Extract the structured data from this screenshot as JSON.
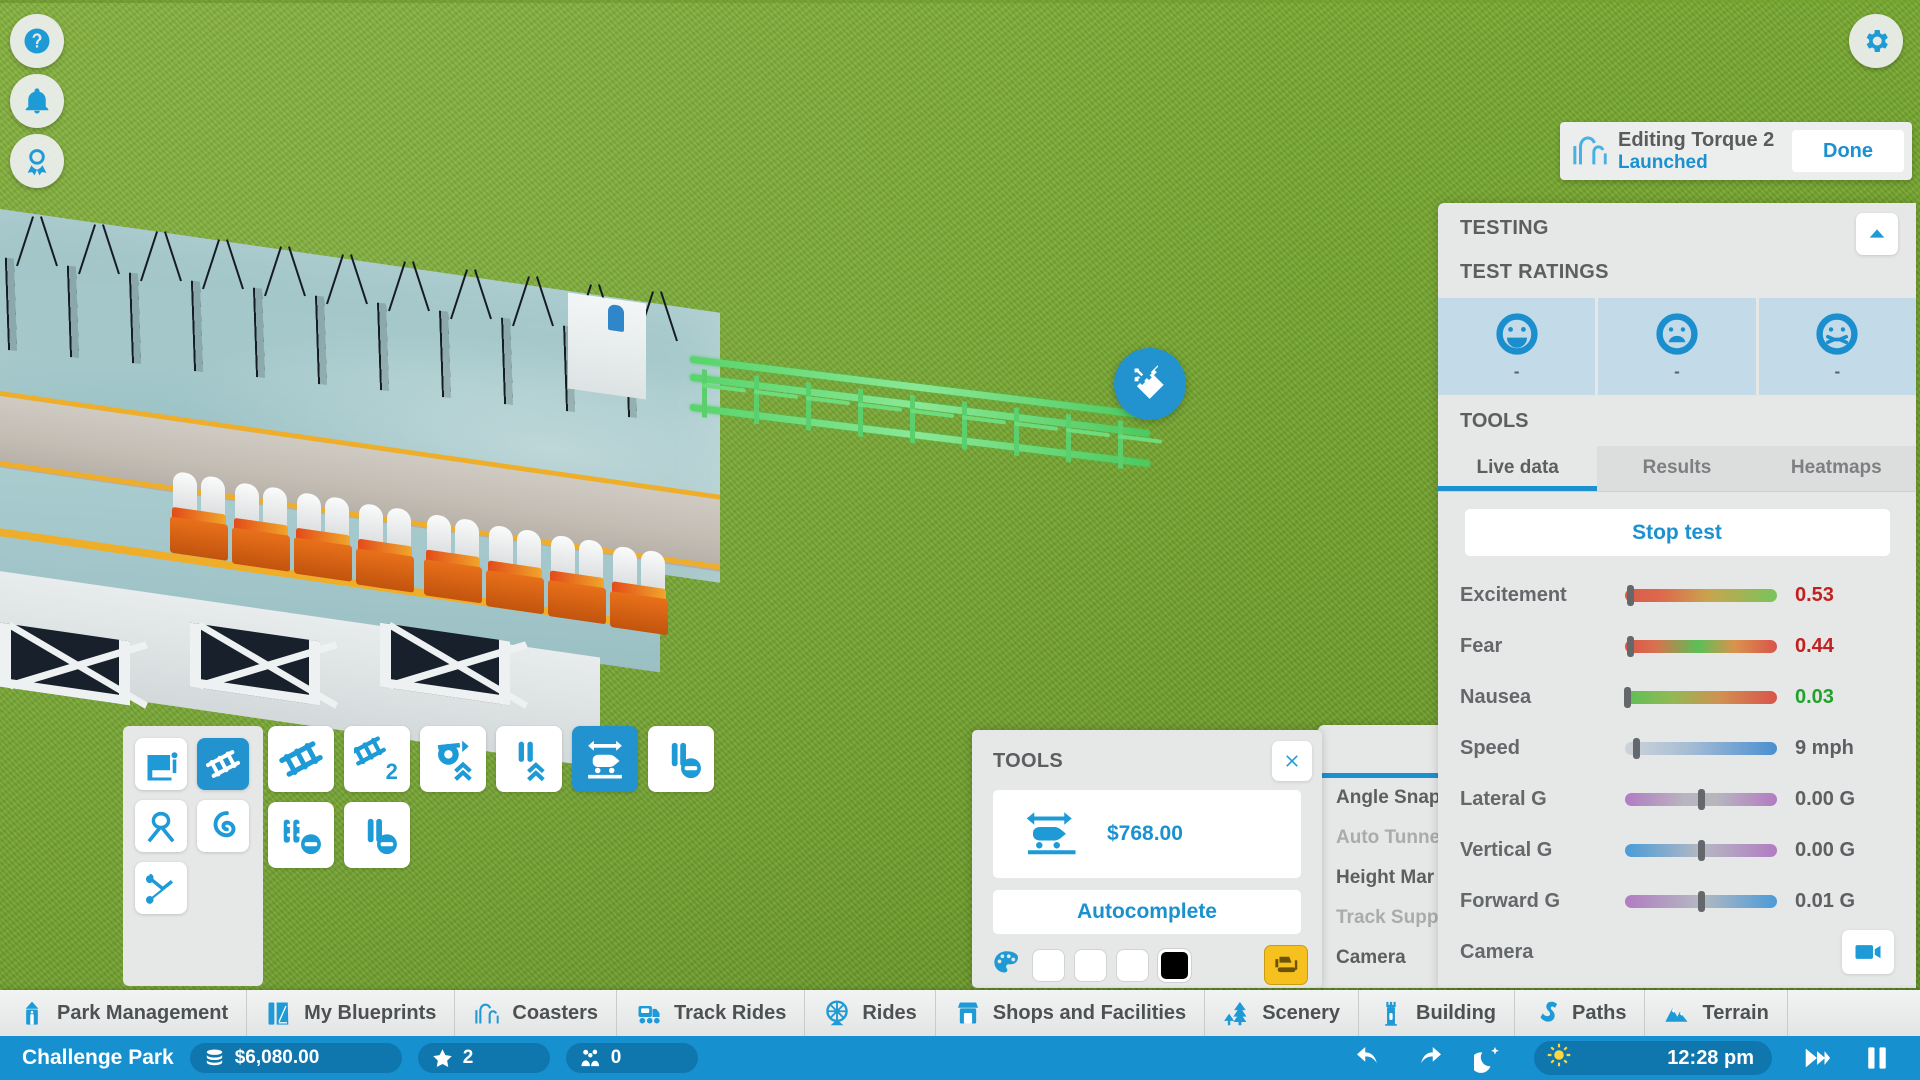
{
  "top_left_buttons": [
    {
      "name": "help-button",
      "icon": "question-icon"
    },
    {
      "name": "notifications-button",
      "icon": "bell-icon"
    },
    {
      "name": "awards-button",
      "icon": "award-icon"
    }
  ],
  "top_right_buttons": [
    {
      "name": "settings-button",
      "icon": "gear-icon"
    }
  ],
  "map_badge": {
    "icon": "measure-ruler-icon"
  },
  "edit_banner": {
    "icon": "coaster-icon",
    "title": "Editing Torque 2",
    "subtitle": "Launched",
    "done_label": "Done"
  },
  "testing_panel": {
    "heading": "TESTING",
    "subheading": "TEST RATINGS",
    "collapse_icon": "chevron-up-icon",
    "ratings": [
      {
        "name": "excitement-rating",
        "icon": "smiley-happy-icon",
        "value": "-"
      },
      {
        "name": "fear-rating",
        "icon": "smiley-fear-icon",
        "value": "-"
      },
      {
        "name": "nausea-rating",
        "icon": "smiley-nausea-icon",
        "value": "-"
      }
    ],
    "tools_label": "TOOLS",
    "tabs": [
      {
        "label": "Live data",
        "active": true
      },
      {
        "label": "Results",
        "active": false
      },
      {
        "label": "Heatmaps",
        "active": false
      }
    ],
    "stop_test_label": "Stop test",
    "metrics": [
      {
        "label": "Excitement",
        "value": "0.53",
        "value_color": "#c32020",
        "knob_pct": 3,
        "gradient": "linear-gradient(90deg,#d95a4a 0%,#dd6b4d 25%,#c9a44e 55%,#79c45a 100%)"
      },
      {
        "label": "Fear",
        "value": "0.44",
        "value_color": "#c32020",
        "knob_pct": 3,
        "gradient": "linear-gradient(90deg,#d9544a 0%,#d9714e 20%,#5cbf57 48%,#d9934e 72%,#d9544a 100%)"
      },
      {
        "label": "Nausea",
        "value": "0.03",
        "value_color": "#21a32b",
        "knob_pct": 1,
        "gradient": "linear-gradient(90deg,#5cbf57 0%,#8fba55 30%,#d09152 62%,#d9544a 100%)"
      },
      {
        "label": "Speed",
        "value": "9 mph",
        "value_color": "#5d6063",
        "knob_pct": 7,
        "gradient": "linear-gradient(90deg,#cdd3d8 0%,#a9bed4 40%,#4a8fd0 100%)"
      },
      {
        "label": "Lateral G",
        "value": "0.00 G",
        "value_color": "#5d6063",
        "knob_pct": 50,
        "gradient": "linear-gradient(90deg,#b17cc2 0%,#b9b5c0 40%,#b9b5bf 60%,#b17cc2 100%)"
      },
      {
        "label": "Vertical G",
        "value": "0.00 G",
        "value_color": "#5d6063",
        "knob_pct": 50,
        "gradient": "linear-gradient(90deg,#4a9bd8 0%,#b4b9c2 50%,#b17cc2 100%)"
      },
      {
        "label": "Forward G",
        "value": "0.01 G",
        "value_color": "#5d6063",
        "knob_pct": 50,
        "gradient": "linear-gradient(90deg,#b17cc2 0%,#b4b9c2 50%,#4a9bd8 100%)"
      }
    ],
    "camera": {
      "label": "Camera",
      "icon": "video-camera-icon"
    }
  },
  "behind_panel": {
    "tab_icon": "clipboard-icon",
    "items": [
      {
        "label": "Angle Snap",
        "dim": false
      },
      {
        "label": "Auto Tunne",
        "dim": true
      },
      {
        "label": "Height Mar",
        "dim": false
      },
      {
        "label": "Track Supp",
        "dim": true
      },
      {
        "label": "Camera",
        "dim": false
      }
    ]
  },
  "tools_popup": {
    "title": "TOOLS",
    "close_icon": "close-icon",
    "price_icon": "launch-track-icon",
    "price": "$768.00",
    "autocomplete_label": "Autocomplete",
    "palette_icon": "palette-icon",
    "swatches": [
      "#ffffff",
      "#ffffff",
      "#ffffff",
      "#000000"
    ],
    "bulldoze_icon": "bulldozer-icon"
  },
  "left_palette": {
    "tiles": [
      {
        "name": "station-tool",
        "icon": "station-icon",
        "selected": false
      },
      {
        "name": "track-tool",
        "icon": "track-piece-icon",
        "selected": true
      },
      {
        "name": "loop-tool",
        "icon": "loop-icon",
        "selected": false
      },
      {
        "name": "helix-tool",
        "icon": "helix-icon",
        "selected": false
      },
      {
        "name": "scissor-tool",
        "icon": "scissor-track-icon",
        "selected": false
      }
    ]
  },
  "main_palette": {
    "tiles": [
      {
        "name": "track-piece-button",
        "icon": "track-piece-icon",
        "selected": false
      },
      {
        "name": "track-piece-2-button",
        "icon": "track-piece-2-icon",
        "selected": false
      },
      {
        "name": "brake-remove-button",
        "icon": "brake-remove-icon",
        "selected": false
      },
      {
        "name": "spinner-up-button",
        "icon": "spinner-up-icon",
        "selected": false
      },
      {
        "name": "brakes-up-button",
        "icon": "brakes-up-icon",
        "selected": false
      },
      {
        "name": "launch-track-button",
        "icon": "launch-track-icon",
        "selected": true
      },
      {
        "name": "brakes-remove-button",
        "icon": "brakes-remove-icon",
        "selected": false
      }
    ]
  },
  "navbar": {
    "items": [
      {
        "label": "Park Management",
        "icon": "park-management-icon"
      },
      {
        "label": "My Blueprints",
        "icon": "blueprints-icon"
      },
      {
        "label": "Coasters",
        "icon": "coaster-icon"
      },
      {
        "label": "Track Rides",
        "icon": "train-icon"
      },
      {
        "label": "Rides",
        "icon": "ferris-wheel-icon"
      },
      {
        "label": "Shops and Facilities",
        "icon": "shop-icon"
      },
      {
        "label": "Scenery",
        "icon": "tree-icon"
      },
      {
        "label": "Building",
        "icon": "tower-icon"
      },
      {
        "label": "Paths",
        "icon": "path-icon"
      },
      {
        "label": "Terrain",
        "icon": "mountain-icon"
      }
    ]
  },
  "statusbar": {
    "park_name": "Challenge Park",
    "money": "$6,080.00",
    "money_icon": "coins-icon",
    "stars": "2",
    "stars_icon": "star-icon",
    "guests": "0",
    "guests_icon": "guests-icon",
    "undo_icon": "undo-icon",
    "redo_icon": "redo-icon",
    "night_icon": "moon-star-icon",
    "sun_icon": "sun-icon",
    "time": "12:28 pm",
    "fastforward_icon": "fast-forward-icon",
    "pause_icon": "pause-icon"
  }
}
